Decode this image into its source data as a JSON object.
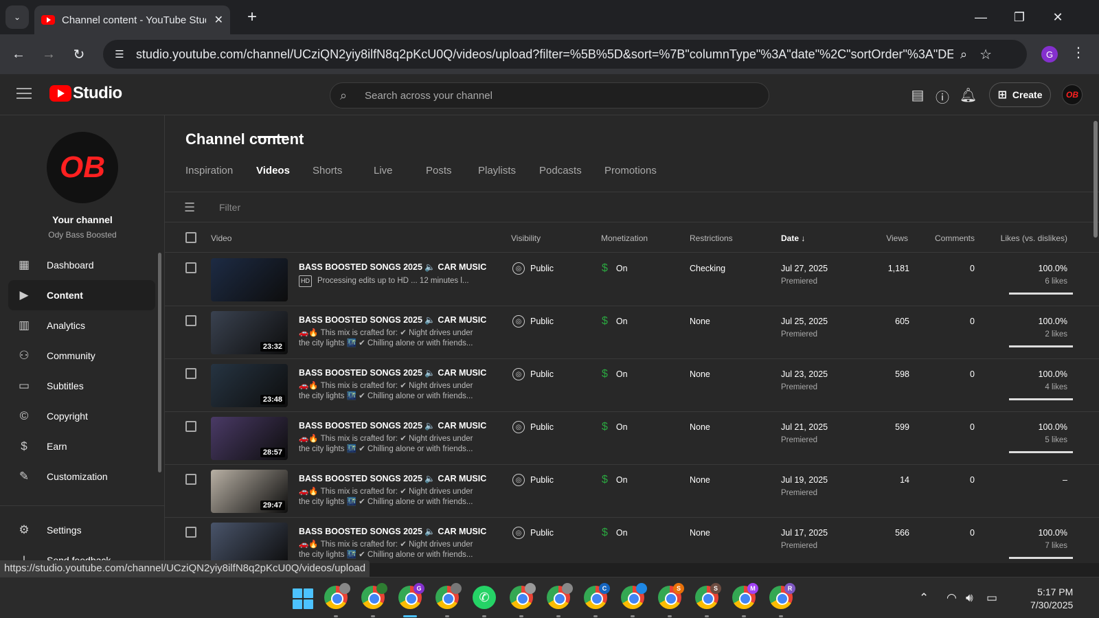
{
  "browser": {
    "tab_title": "Channel content - YouTube Studio",
    "url": "studio.youtube.com/channel/UCziQN2yiy8ilfN8q2pKcU0Q/videos/upload?filter=%5B%5D&sort=%7B\"columnType\"%3A\"date\"%2C\"sortOrder\"%3A\"DESCE...",
    "profile_letter": "G",
    "status_url": "https://studio.youtube.com/channel/UCziQN2yiy8ilfN8q2pKcU0Q/videos/upload"
  },
  "header": {
    "logo_text": "Studio",
    "search_placeholder": "Search across your channel",
    "create_label": "Create",
    "avatar_text": "OB"
  },
  "sidebar": {
    "avatar_text": "OB",
    "channel_label": "Your channel",
    "channel_name": "Ody Bass Boosted",
    "items": [
      {
        "label": "Dashboard",
        "icon": "dashboard-icon"
      },
      {
        "label": "Content",
        "icon": "content-icon",
        "active": true
      },
      {
        "label": "Analytics",
        "icon": "analytics-icon"
      },
      {
        "label": "Community",
        "icon": "community-icon"
      },
      {
        "label": "Subtitles",
        "icon": "subtitles-icon"
      },
      {
        "label": "Copyright",
        "icon": "copyright-icon"
      },
      {
        "label": "Earn",
        "icon": "earn-icon"
      },
      {
        "label": "Customization",
        "icon": "customization-icon"
      }
    ],
    "settings_label": "Settings",
    "feedback_label": "Send feedback"
  },
  "main": {
    "title": "Channel content",
    "tabs": [
      "Inspiration",
      "Videos",
      "Shorts",
      "Live",
      "Posts",
      "Playlists",
      "Podcasts",
      "Promotions"
    ],
    "active_tab": "Videos",
    "filter_placeholder": "Filter",
    "columns": {
      "video": "Video",
      "visibility": "Visibility",
      "monetization": "Monetization",
      "restrictions": "Restrictions",
      "date": "Date",
      "views": "Views",
      "comments": "Comments",
      "likes": "Likes (vs. dislikes)"
    }
  },
  "videos": [
    {
      "title": "BASS BOOSTED SONGS 2025 🔈 CAR MUSIC MI...",
      "desc1": "Processing edits up to HD ... 12 minutes l...",
      "desc2": "",
      "duration": "",
      "visibility": "Public",
      "monetization": "On",
      "restrictions": "Checking",
      "date": "Jul 27, 2025",
      "date_sub": "Premiered",
      "views": "1,181",
      "comments": "0",
      "likes_pct": "100.0%",
      "likes_count": "6 likes",
      "likes_ratio": 1.0,
      "processing": true
    },
    {
      "title": "BASS BOOSTED SONGS 2025 🔈 CAR MUSIC MI...",
      "desc1": "🚗🔥 This mix is crafted for: ✔ Night drives under",
      "desc2": "the city lights 🌃 ✔ Chilling alone or with friends...",
      "duration": "23:32",
      "visibility": "Public",
      "monetization": "On",
      "restrictions": "None",
      "date": "Jul 25, 2025",
      "date_sub": "Premiered",
      "views": "605",
      "comments": "0",
      "likes_pct": "100.0%",
      "likes_count": "2 likes",
      "likes_ratio": 1.0
    },
    {
      "title": "BASS BOOSTED SONGS 2025 🔈 CAR MUSIC MI...",
      "desc1": "🚗🔥 This mix is crafted for: ✔ Night drives under",
      "desc2": "the city lights 🌃 ✔ Chilling alone or with friends...",
      "duration": "23:48",
      "visibility": "Public",
      "monetization": "On",
      "restrictions": "None",
      "date": "Jul 23, 2025",
      "date_sub": "Premiered",
      "views": "598",
      "comments": "0",
      "likes_pct": "100.0%",
      "likes_count": "4 likes",
      "likes_ratio": 1.0
    },
    {
      "title": "BASS BOOSTED SONGS 2025 🔈 CAR MUSIC MI...",
      "desc1": "🚗🔥 This mix is crafted for: ✔ Night drives under",
      "desc2": "the city lights 🌃 ✔ Chilling alone or with friends...",
      "duration": "28:57",
      "visibility": "Public",
      "monetization": "On",
      "restrictions": "None",
      "date": "Jul 21, 2025",
      "date_sub": "Premiered",
      "views": "599",
      "comments": "0",
      "likes_pct": "100.0%",
      "likes_count": "5 likes",
      "likes_ratio": 1.0
    },
    {
      "title": "BASS BOOSTED SONGS 2025 🔈 CAR MUSIC MI...",
      "desc1": "🚗🔥 This mix is crafted for: ✔ Night drives under",
      "desc2": "the city lights 🌃 ✔ Chilling alone or with friends...",
      "duration": "29:47",
      "visibility": "Public",
      "monetization": "On",
      "restrictions": "None",
      "date": "Jul 19, 2025",
      "date_sub": "Premiered",
      "views": "14",
      "comments": "0",
      "likes_pct": "–",
      "likes_count": "",
      "likes_ratio": null
    },
    {
      "title": "BASS BOOSTED SONGS 2025 🔈 CAR MUSIC MI...",
      "desc1": "🚗🔥 This mix is crafted for: ✔ Night drives under",
      "desc2": "the city lights 🌃 ✔ Chilling alone or with friends...",
      "duration": "",
      "visibility": "Public",
      "monetization": "On",
      "restrictions": "None",
      "date": "Jul 17, 2025",
      "date_sub": "Premiered",
      "views": "566",
      "comments": "0",
      "likes_pct": "100.0%",
      "likes_count": "7 likes",
      "likes_ratio": 1.0
    }
  ],
  "thumb_colors": [
    "#1d2b44",
    "#3a4250",
    "#263442",
    "#4a3a66",
    "#b8b0a4",
    "#49546a"
  ],
  "taskbar": {
    "badges": [
      "",
      "",
      "G",
      "",
      "",
      "",
      "",
      "C",
      "",
      "S",
      "S",
      "M",
      "R"
    ],
    "time": "5:17 PM",
    "date": "7/30/2025"
  }
}
